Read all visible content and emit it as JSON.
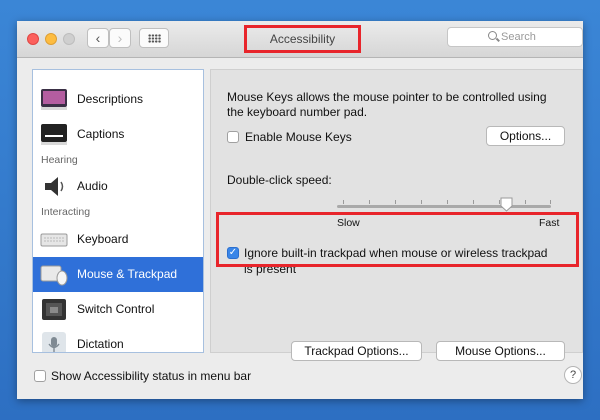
{
  "window": {
    "title": "Accessibility"
  },
  "toolbar": {
    "back_glyph": "‹",
    "forward_glyph": "›"
  },
  "search": {
    "placeholder": "Search"
  },
  "sidebar": {
    "items": [
      {
        "label": "Descriptions",
        "icon": "descriptions-icon"
      },
      {
        "label": "Captions",
        "icon": "captions-icon"
      },
      {
        "label": "Audio",
        "icon": "speaker-icon"
      },
      {
        "label": "Keyboard",
        "icon": "keyboard-icon"
      },
      {
        "label": "Mouse & Trackpad",
        "icon": "trackpad-icon",
        "selected": true
      },
      {
        "label": "Switch Control",
        "icon": "switch-control-icon"
      },
      {
        "label": "Dictation",
        "icon": "microphone-icon"
      }
    ],
    "headers": {
      "hearing": "Hearing",
      "interacting": "Interacting"
    }
  },
  "content": {
    "mouse_keys_desc_line1": "Mouse Keys allows the mouse pointer to be controlled using",
    "mouse_keys_desc_line2": "the keyboard number pad.",
    "enable_mouse_keys": {
      "label": "Enable Mouse Keys",
      "checked": false
    },
    "options_button": "Options...",
    "double_click_label": "Double-click speed:",
    "slider": {
      "min_label": "Slow",
      "max_label": "Fast",
      "value": 0.8
    },
    "ignore_trackpad": {
      "label_line1": "Ignore built-in trackpad when mouse or wireless trackpad",
      "label_line2": "is present",
      "checked": true
    },
    "trackpad_options_button": "Trackpad Options...",
    "mouse_options_button": "Mouse Options..."
  },
  "footer": {
    "show_status_label": "Show Accessibility status in menu bar",
    "show_status_checked": false,
    "help_glyph": "?"
  },
  "colors": {
    "highlight": "#e8252b",
    "selection": "#2f70d9",
    "desktop": "#2f73c8"
  }
}
